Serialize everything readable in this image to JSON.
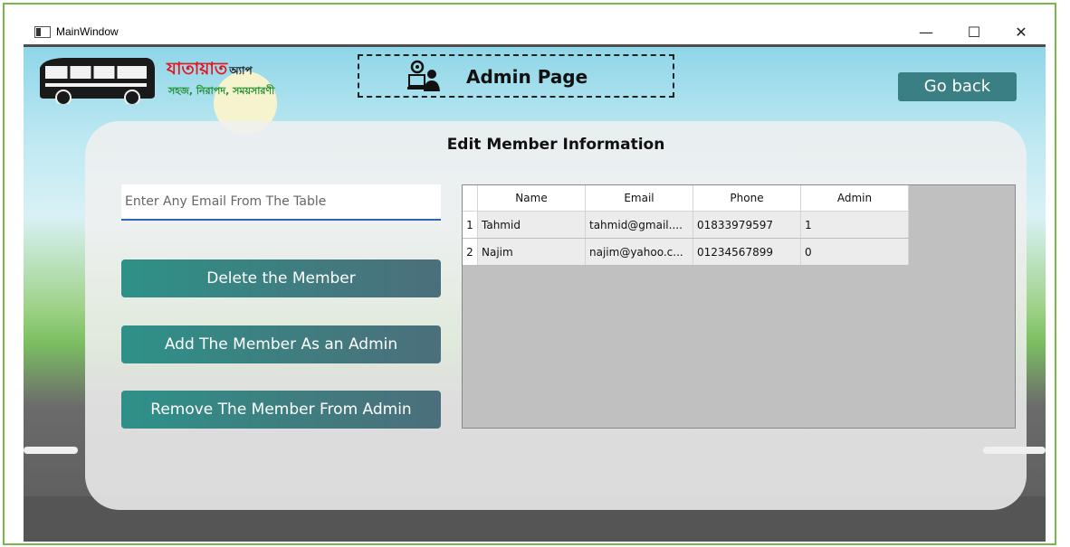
{
  "window": {
    "title": "MainWindow",
    "minimize_symbol": "—",
    "maximize_symbol": "☐",
    "close_symbol": "✕"
  },
  "header": {
    "logo_title": "যাতায়াত",
    "logo_app": "অ্যাপ",
    "logo_tagline": "সহজ, নিরাপদ, সময়সারণী",
    "page_title": "Admin Page",
    "go_back_label": "Go back"
  },
  "panel": {
    "title": "Edit Member Information",
    "email_placeholder": "Enter Any Email From The Table",
    "buttons": {
      "delete": "Delete the Member",
      "add_admin": "Add The Member As an Admin",
      "remove_admin": "Remove The Member From Admin"
    }
  },
  "table": {
    "columns": [
      "Name",
      "Email",
      "Phone",
      "Admin"
    ],
    "rows": [
      {
        "index": "1",
        "name": "Tahmid",
        "email": "tahmid@gmail....",
        "phone": "01833979597",
        "admin": "1"
      },
      {
        "index": "2",
        "name": "Najim",
        "email": "najim@yahoo.c...",
        "phone": "01234567899",
        "admin": "0"
      }
    ]
  },
  "colors": {
    "frame_border": "#78b84a",
    "button_teal": "#2e9189",
    "go_back_bg": "#3a7f83",
    "input_underline": "#2b66b5",
    "logo_red": "#e8141c",
    "logo_green": "#1e8e2f"
  }
}
